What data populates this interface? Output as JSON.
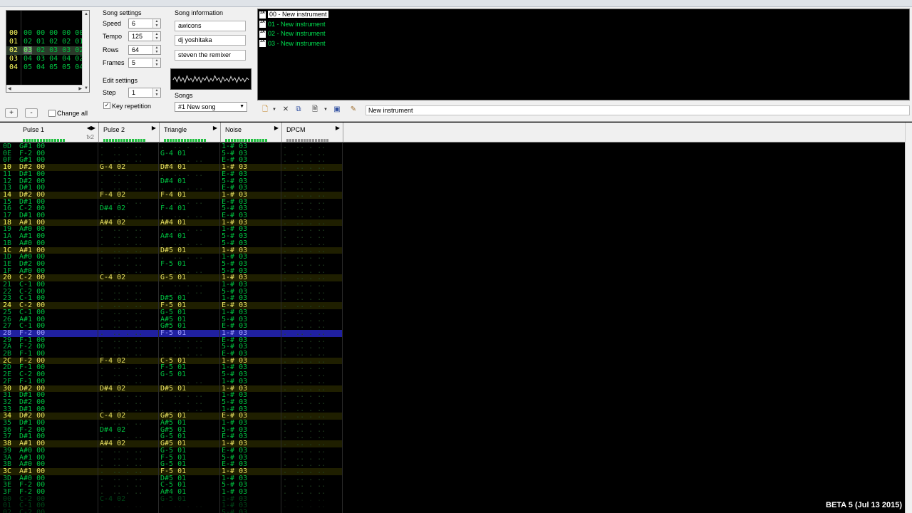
{
  "frames": {
    "rows": [
      {
        "num": "00",
        "pattern": "00 00 00 00 00"
      },
      {
        "num": "01",
        "pattern": "02 01 02 02 01"
      },
      {
        "num": "02",
        "pattern": "03 02 03 03 02",
        "selected": true
      },
      {
        "num": "03",
        "pattern": "04 03 04 04 02"
      },
      {
        "num": "04",
        "pattern": "05 04 05 05 04"
      }
    ],
    "add_label": "+",
    "remove_label": "-",
    "change_all_label": "Change all"
  },
  "song_settings": {
    "title": "Song settings",
    "speed_label": "Speed",
    "speed": "6",
    "tempo_label": "Tempo",
    "tempo": "125",
    "rows_label": "Rows",
    "rows": "64",
    "frames_label": "Frames",
    "frames": "5"
  },
  "edit_settings": {
    "title": "Edit settings",
    "step_label": "Step",
    "step": "1",
    "key_repetition_label": "Key repetition"
  },
  "song_info": {
    "title": "Song information",
    "name": "awicons",
    "artist": "dj yoshitaka",
    "copyright": "steven the remixer"
  },
  "songs": {
    "label": "Songs",
    "selected": "#1 New song"
  },
  "instruments": [
    {
      "label": "00 - New instrument",
      "selected": true
    },
    {
      "label": "01 - New instrument"
    },
    {
      "label": "02 - New instrument"
    },
    {
      "label": "03 - New instrument"
    }
  ],
  "instrument_name": "New instrument",
  "channels": [
    {
      "name": "Pulse 1",
      "fx": "fx2"
    },
    {
      "name": "Pulse 2"
    },
    {
      "name": "Triangle"
    },
    {
      "name": "Noise"
    },
    {
      "name": "DPCM"
    }
  ],
  "pattern_rows": [
    [
      "0D",
      "G#1 00",
      "",
      "",
      "1-# 03"
    ],
    [
      "0E",
      "F-2 00",
      "",
      "G-4 01",
      "5-# 03"
    ],
    [
      "0F",
      "G#1 00",
      "",
      "",
      "E-# 03"
    ],
    [
      "10",
      "D#2 00",
      "G-4 02",
      "D#4 01",
      "1-# 03"
    ],
    [
      "11",
      "D#1 00",
      "",
      "",
      "E-# 03"
    ],
    [
      "12",
      "D#2 00",
      "",
      "D#4 01",
      "5-# 03"
    ],
    [
      "13",
      "D#1 00",
      "",
      "",
      "E-# 03"
    ],
    [
      "14",
      "D#2 00",
      "F-4 02",
      "F-4 01",
      "1-# 03"
    ],
    [
      "15",
      "D#1 00",
      "",
      "",
      "E-# 03"
    ],
    [
      "16",
      "C-2 00",
      "D#4 02",
      "F-4 01",
      "5-# 03"
    ],
    [
      "17",
      "D#1 00",
      "",
      "",
      "E-# 03"
    ],
    [
      "18",
      "A#1 00",
      "A#4 02",
      "A#4 01",
      "1-# 03"
    ],
    [
      "19",
      "A#0 00",
      "",
      "",
      "1-# 03"
    ],
    [
      "1A",
      "A#1 00",
      "",
      "A#4 01",
      "5-# 03"
    ],
    [
      "1B",
      "A#0 00",
      "",
      "",
      "5-# 03"
    ],
    [
      "1C",
      "A#1 00",
      "",
      "D#5 01",
      "1-# 03"
    ],
    [
      "1D",
      "A#0 00",
      "",
      "",
      "1-# 03"
    ],
    [
      "1E",
      "D#2 00",
      "",
      "F-5 01",
      "5-# 03"
    ],
    [
      "1F",
      "A#0 00",
      "",
      "",
      "5-# 03"
    ],
    [
      "20",
      "C-2 00",
      "C-4 02",
      "G-5 01",
      "1-# 03"
    ],
    [
      "21",
      "C-1 00",
      "",
      "",
      "1-# 03"
    ],
    [
      "22",
      "C-2 00",
      "",
      "",
      "5-# 03"
    ],
    [
      "23",
      "C-1 00",
      "",
      "D#5 01",
      "1-# 03"
    ],
    [
      "24",
      "C-2 00",
      "",
      "F-5 01",
      "E-# 03"
    ],
    [
      "25",
      "C-1 00",
      "",
      "G-5 01",
      "1-# 03"
    ],
    [
      "26",
      "A#1 00",
      "",
      "A#5 01",
      "5-# 03"
    ],
    [
      "27",
      "C-1 00",
      "",
      "G#5 01",
      "E-# 03"
    ],
    [
      "28",
      "F-2 00",
      "",
      "F-5 01",
      "1-# 03"
    ],
    [
      "29",
      "F-1 00",
      "",
      "",
      "E-# 03"
    ],
    [
      "2A",
      "F-2 00",
      "",
      "",
      "5-# 03"
    ],
    [
      "2B",
      "F-1 00",
      "",
      "",
      "E-# 03"
    ],
    [
      "2C",
      "F-2 00",
      "F-4 02",
      "C-5 01",
      "1-# 03"
    ],
    [
      "2D",
      "F-1 00",
      "",
      "F-5 01",
      "1-# 03"
    ],
    [
      "2E",
      "C-2 00",
      "",
      "G-5 01",
      "5-# 03"
    ],
    [
      "2F",
      "F-1 00",
      "",
      "",
      "1-# 03"
    ],
    [
      "30",
      "D#2 00",
      "D#4 02",
      "D#5 01",
      "1-# 03"
    ],
    [
      "31",
      "D#1 00",
      "",
      "",
      "1-# 03"
    ],
    [
      "32",
      "D#2 00",
      "",
      "",
      "5-# 03"
    ],
    [
      "33",
      "D#1 00",
      "",
      "",
      "1-# 03"
    ],
    [
      "34",
      "D#2 00",
      "C-4 02",
      "G#5 01",
      "E-# 03"
    ],
    [
      "35",
      "D#1 00",
      "",
      "A#5 01",
      "1-# 03"
    ],
    [
      "36",
      "F-2 00",
      "D#4 02",
      "G#5 01",
      "5-# 03"
    ],
    [
      "37",
      "D#1 00",
      "",
      "G-5 01",
      "E-# 03"
    ],
    [
      "38",
      "A#1 00",
      "A#4 02",
      "G#5 01",
      "1-# 03"
    ],
    [
      "39",
      "A#0 00",
      "",
      "G-5 01",
      "E-# 03"
    ],
    [
      "3A",
      "A#1 00",
      "",
      "F-5 01",
      "5-# 03"
    ],
    [
      "3B",
      "A#0 00",
      "",
      "G-5 01",
      "E-# 03"
    ],
    [
      "3C",
      "A#1 00",
      "",
      "F-5 01",
      "1-# 03"
    ],
    [
      "3D",
      "A#0 00",
      "",
      "D#5 01",
      "1-# 03"
    ],
    [
      "3E",
      "F-2 00",
      "",
      "C-5 01",
      "5-# 03"
    ],
    [
      "3F",
      "F-2 00",
      "",
      "A#4 01",
      "1-# 03"
    ],
    [
      "00",
      "C-2 00",
      "C-4 02",
      "G-5 01",
      "1-# 03"
    ],
    [
      "01",
      "C-1 00",
      "",
      "",
      "1-# 03"
    ],
    [
      "02",
      "C-2 00",
      "",
      "",
      "5-# 03"
    ]
  ],
  "version": "BETA 5 (Jul 13 2015)",
  "colors": {
    "note_green": "#00c040",
    "highlight_yellow": "#e8e060",
    "cursor_row": "#2020a0"
  }
}
